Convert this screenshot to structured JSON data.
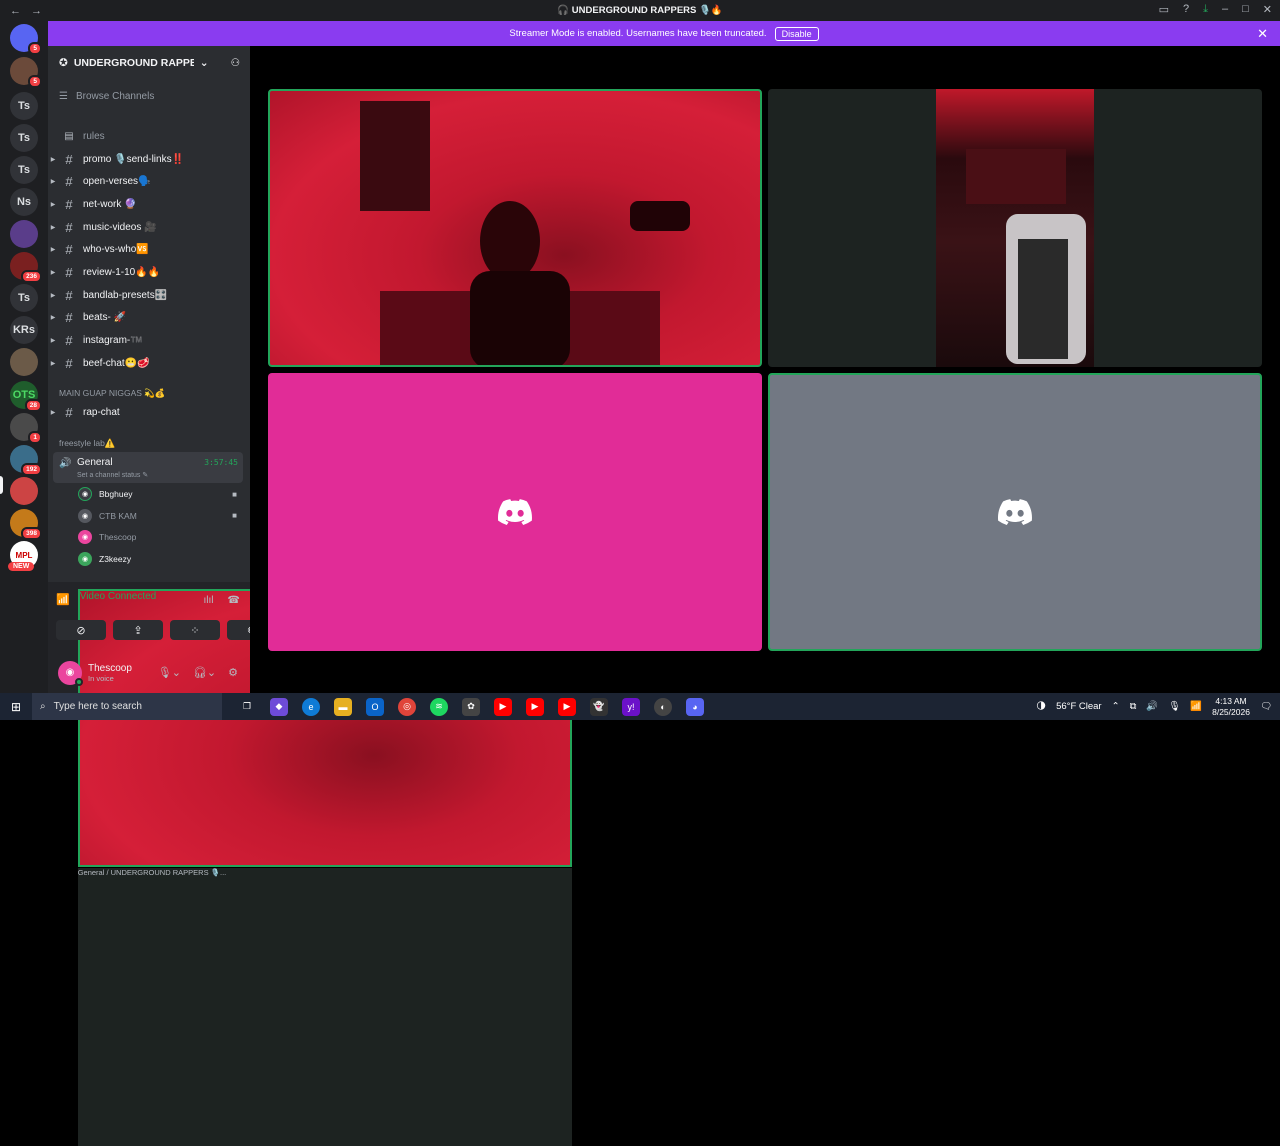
{
  "window": {
    "title": "🎧 UNDERGROUND RAPPERS 🎙️🔥",
    "back": "←",
    "forward": "→"
  },
  "banner": {
    "text": "Streamer Mode is enabled. Usernames have been truncated.",
    "button": "Disable"
  },
  "guilds": [
    {
      "label": "",
      "badge": "5"
    },
    {
      "label": "",
      "badge": "5"
    },
    {
      "label": "Ts",
      "badge": ""
    },
    {
      "label": "Ts",
      "badge": ""
    },
    {
      "label": "Ts",
      "badge": ""
    },
    {
      "label": "Ns",
      "badge": ""
    },
    {
      "label": "",
      "badge": ""
    },
    {
      "label": "",
      "badge": "236"
    },
    {
      "label": "Ts",
      "badge": ""
    },
    {
      "label": "KRs",
      "badge": ""
    },
    {
      "label": "",
      "badge": ""
    },
    {
      "label": "OTS",
      "badge": "28"
    },
    {
      "label": "",
      "badge": "1"
    },
    {
      "label": "",
      "badge": "192"
    },
    {
      "label": "",
      "badge": ""
    },
    {
      "label": "",
      "badge": "398"
    },
    {
      "label": "MPL",
      "badge": ""
    }
  ],
  "guild_new": "NEW",
  "server": {
    "name": "UNDERGROUND RAPPE...",
    "browse": "Browse Channels"
  },
  "channels": [
    {
      "name": "rules",
      "muted": true
    },
    {
      "name": "promo 🎙️send-links‼️"
    },
    {
      "name": "open-verses🗣️"
    },
    {
      "name": "net-work 🔮"
    },
    {
      "name": "music-videos 🎥"
    },
    {
      "name": "who-vs-who🆚"
    },
    {
      "name": "review-1-10🔥🔥"
    },
    {
      "name": "bandlab-presets🎛️"
    },
    {
      "name": "beats- 🚀"
    },
    {
      "name": "instagram-™️"
    },
    {
      "name": "beef-chat😬🥩"
    }
  ],
  "category2": "MAIN GUAP NIGGAS 💫💰",
  "channel_rap": "rap-chat",
  "category3": "freestyle lab⚠️",
  "voice": {
    "name": "General",
    "status": "Set a channel status ✎",
    "timer": "3:57:45"
  },
  "members": [
    {
      "name": "Bbghuey",
      "color": "#3a3c42",
      "cam": true
    },
    {
      "name": "CTB KAM",
      "color": "#55585f",
      "cam": true,
      "dim": true
    },
    {
      "name": "Thescoop",
      "color": "#eb459e",
      "dim": true
    },
    {
      "name": "Z3keezy",
      "color": "#3ba55c"
    }
  ],
  "voice_panel": {
    "status": "Video Connected",
    "location": "General / UNDERGROUND RAPPERS 🎙️..."
  },
  "user": {
    "name": "Thescoop",
    "status": "In voice"
  },
  "taskbar": {
    "search": "Type here to search",
    "weather": "56°F  Clear",
    "time": "4:13 AM",
    "date": "8/25/2026"
  },
  "colors": {
    "accent": "#8a3cf0",
    "tile_pink": "#e12c97",
    "tile_gray": "#727883",
    "speaking": "#23a55a"
  }
}
